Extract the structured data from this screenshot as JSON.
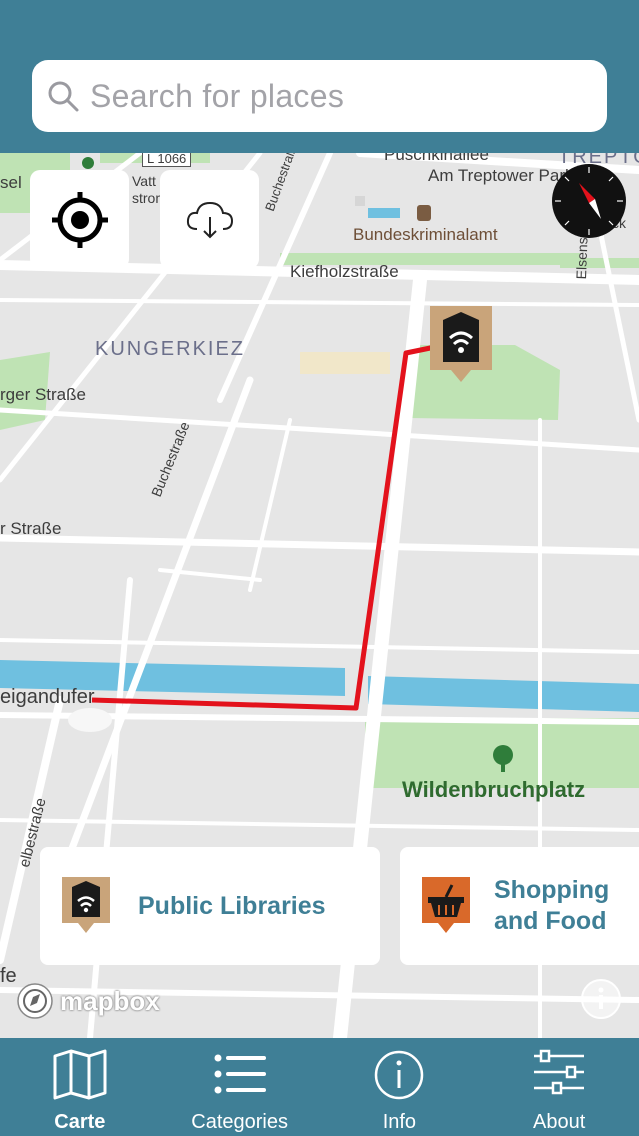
{
  "search": {
    "placeholder": "Search for places"
  },
  "map": {
    "street_labels": {
      "l1066": "L 1066",
      "puschkinallee": "Puschkinallee",
      "treptow": "TREPTO",
      "am_treptower_park": "Am Treptower Park",
      "vattstrom": "Vatt\nstrom",
      "bundeskriminalamt": "Bundeskriminalamt",
      "kiefholzstrasse": "Kiefholzstraße",
      "kungerkiez": "KUNGERKIEZ",
      "erger_strasse": "rger Straße",
      "buchestrasse_top": "Buchestraße",
      "buchestrasse_mid": "Buchestraße",
      "r_strasse": "r Straße",
      "eigandufer": "eigandufer",
      "wildenbruchplatz": "Wildenbruchplatz",
      "elsenstrasse": "Elsenstraße",
      "lbestrasse": "elbestraße",
      "sel": "sel",
      "ck": "ck",
      "fe": "fe"
    },
    "attribution": "mapbox"
  },
  "buttons": {
    "locate_icon": "crosshair-locate-icon",
    "download_icon": "cloud-download-icon",
    "compass_icon": "compass-icon"
  },
  "cards": [
    {
      "label": "Public Libraries",
      "icon": "library-wifi-pin-icon",
      "color": "#3f7f96"
    },
    {
      "label": "Shopping and Food",
      "icon": "shopping-basket-pin-icon",
      "color": "#3f7f96"
    }
  ],
  "tabs": [
    {
      "label": "Carte",
      "icon": "map-icon",
      "active": true
    },
    {
      "label": "Categories",
      "icon": "list-icon",
      "active": false
    },
    {
      "label": "Info",
      "icon": "info-icon",
      "active": false
    },
    {
      "label": "About",
      "icon": "sliders-icon",
      "active": false
    }
  ],
  "colors": {
    "brand": "#3f7f96",
    "route": "#e3121c",
    "water": "#6fc0e0",
    "park": "#bfe3b4"
  }
}
